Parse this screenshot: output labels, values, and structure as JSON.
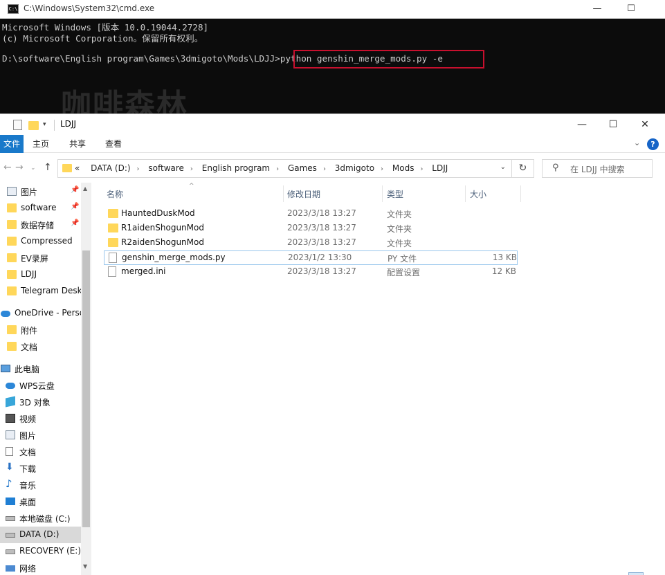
{
  "cmd": {
    "title": "C:\\Windows\\System32\\cmd.exe",
    "line1": "Microsoft Windows [版本 10.0.19044.2728]",
    "line2": "(c) Microsoft Corporation。保留所有权利。",
    "prompt": "D:\\software\\English program\\Games\\3dmigoto\\Mods\\LDJJ>",
    "command": "python genshin_merge_mods.py -e",
    "watermark": "咖啡森林",
    "controls": {
      "minimize": "—",
      "maximize": "☐"
    }
  },
  "explorer": {
    "title": "LDJJ",
    "controls": {
      "minimize": "—",
      "maximize": "☐",
      "close": "✕"
    },
    "ribbon": {
      "file": "文件",
      "home": "主页",
      "share": "共享",
      "view": "查看"
    },
    "address": {
      "prefix": "«",
      "crumbs": [
        "DATA (D:)",
        "software",
        "English program",
        "Games",
        "3dmigoto",
        "Mods",
        "LDJJ"
      ]
    },
    "search_placeholder": "在 LDJJ 中搜索",
    "nav_items": [
      {
        "label": "图片",
        "icon": "pictures-icon",
        "pinned": true
      },
      {
        "label": "software",
        "icon": "folder-icon",
        "pinned": true
      },
      {
        "label": "数据存储",
        "icon": "folder-icon",
        "pinned": true
      },
      {
        "label": "Compressed",
        "icon": "folder-icon",
        "pinned": false
      },
      {
        "label": "EV录屏",
        "icon": "folder-icon",
        "pinned": false
      },
      {
        "label": "LDJJ",
        "icon": "folder-icon",
        "pinned": false
      },
      {
        "label": "Telegram Desk",
        "icon": "folder-icon",
        "pinned": false
      },
      {
        "label": "OneDrive - Perso",
        "icon": "onedrive-icon",
        "pinned": false
      },
      {
        "label": "附件",
        "icon": "folder-icon",
        "pinned": false
      },
      {
        "label": "文档",
        "icon": "folder-icon",
        "pinned": false
      },
      {
        "label": "此电脑",
        "icon": "this-pc-icon",
        "pinned": false
      },
      {
        "label": "WPS云盘",
        "icon": "wps-cloud-icon",
        "pinned": false
      },
      {
        "label": "3D 对象",
        "icon": "3d-objects-icon",
        "pinned": false
      },
      {
        "label": "视频",
        "icon": "videos-icon",
        "pinned": false
      },
      {
        "label": "图片",
        "icon": "pictures-icon",
        "pinned": false
      },
      {
        "label": "文档",
        "icon": "documents-icon",
        "pinned": false
      },
      {
        "label": "下载",
        "icon": "downloads-icon",
        "pinned": false
      },
      {
        "label": "音乐",
        "icon": "music-icon",
        "pinned": false
      },
      {
        "label": "桌面",
        "icon": "desktop-icon",
        "pinned": false
      },
      {
        "label": "本地磁盘 (C:)",
        "icon": "drive-icon",
        "pinned": false
      },
      {
        "label": "DATA (D:)",
        "icon": "drive-icon",
        "pinned": false,
        "selected": true
      },
      {
        "label": "RECOVERY (E:)",
        "icon": "drive-icon",
        "pinned": false
      },
      {
        "label": "网络",
        "icon": "network-icon",
        "pinned": false
      }
    ],
    "columns": {
      "name": "名称",
      "date": "修改日期",
      "type": "类型",
      "size": "大小"
    },
    "files": [
      {
        "name": "HauntedDuskMod",
        "date": "2023/3/18 13:27",
        "type": "文件夹",
        "size": "",
        "icon": "folder-icon"
      },
      {
        "name": "R1aidenShogunMod",
        "date": "2023/3/18 13:27",
        "type": "文件夹",
        "size": "",
        "icon": "folder-icon"
      },
      {
        "name": "R2aidenShogunMod",
        "date": "2023/3/18 13:27",
        "type": "文件夹",
        "size": "",
        "icon": "folder-icon"
      },
      {
        "name": "genshin_merge_mods.py",
        "date": "2023/1/2 13:30",
        "type": "PY 文件",
        "size": "13 KB",
        "icon": "python-file-icon",
        "selected": true
      },
      {
        "name": "merged.ini",
        "date": "2023/3/18 13:27",
        "type": "配置设置",
        "size": "12 KB",
        "icon": "ini-file-icon"
      }
    ]
  }
}
